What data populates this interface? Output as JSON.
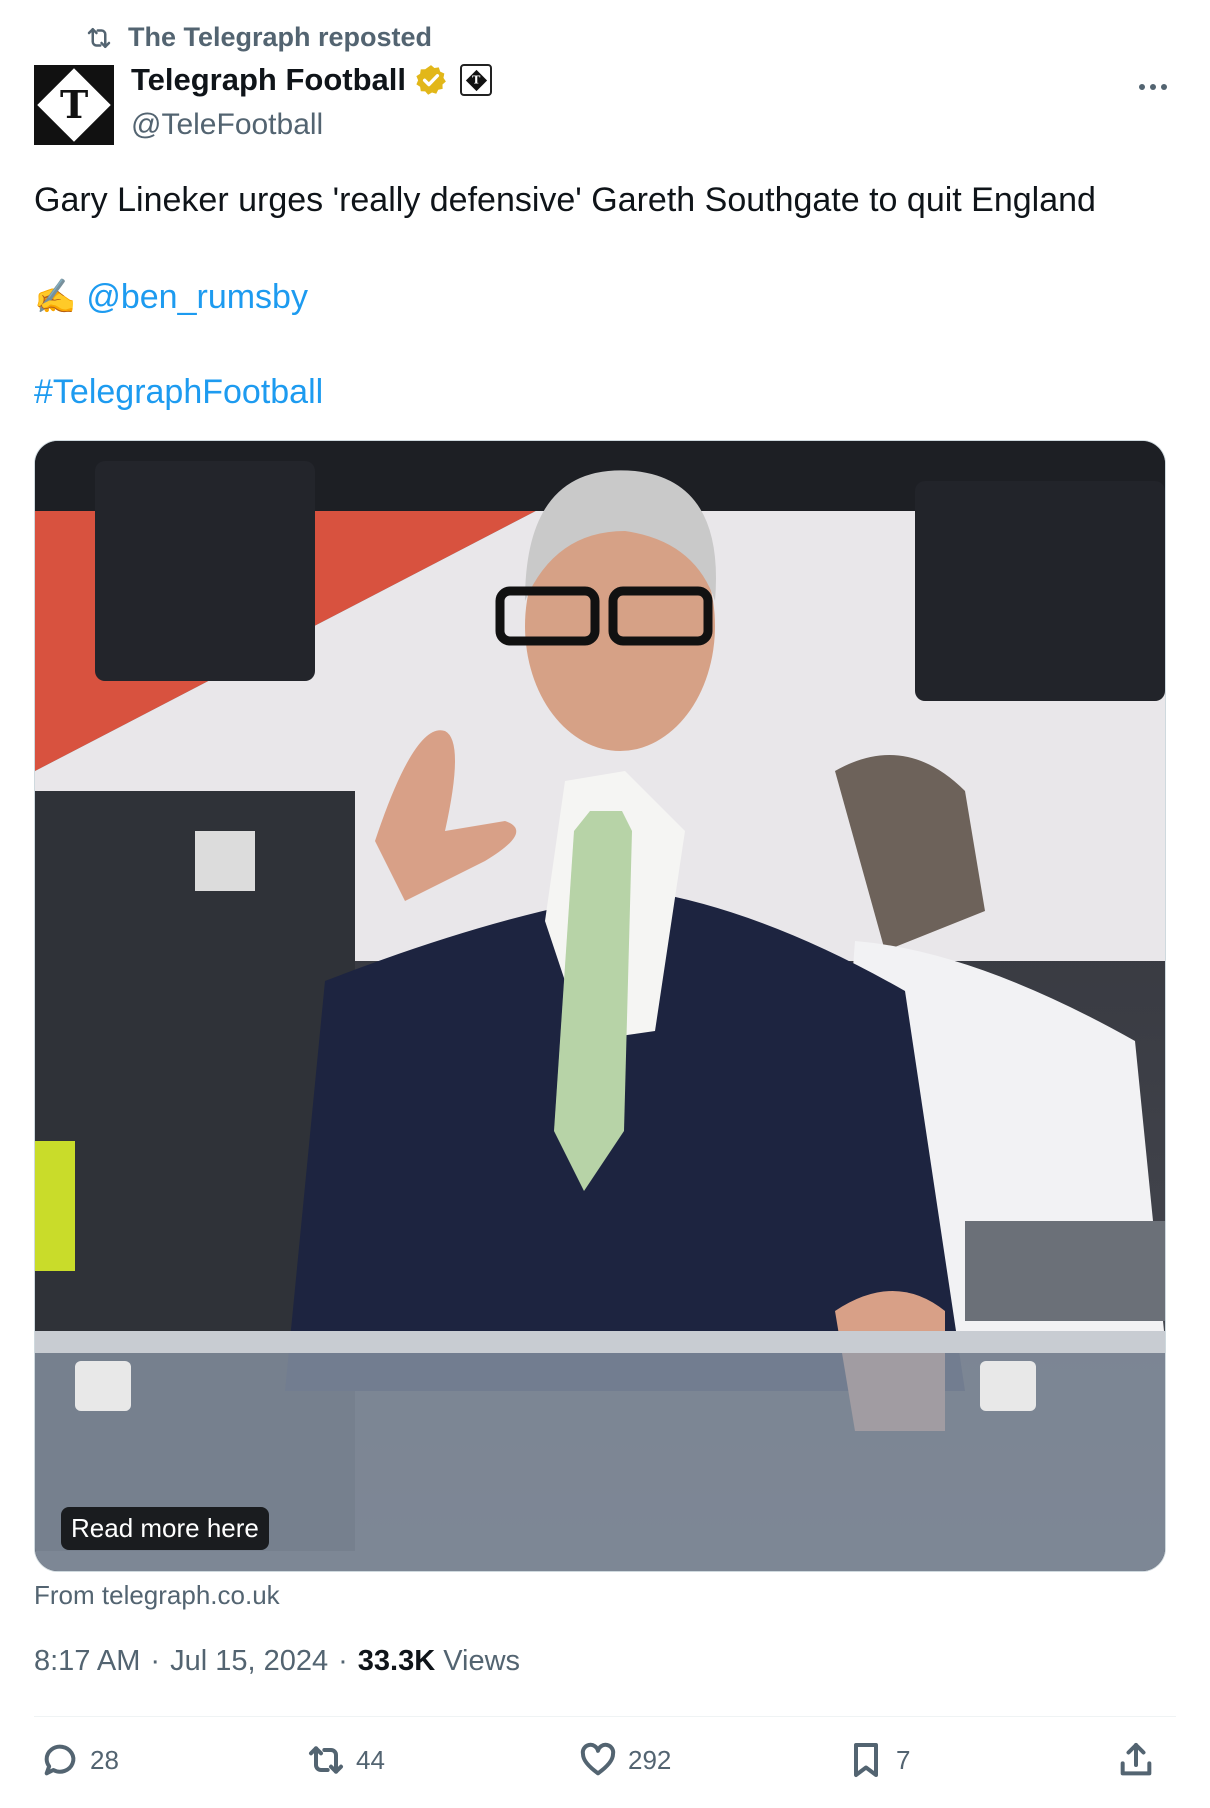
{
  "repost": {
    "label": "The Telegraph reposted",
    "icon": "repost-icon"
  },
  "author": {
    "display_name": "Telegraph Football",
    "handle": "@TeleFootball",
    "verified_color": "#e2b719",
    "avatar_letter": "T"
  },
  "tweet": {
    "headline": "Gary Lineker urges 'really defensive' Gareth Southgate to quit England",
    "pen_emoji": "✍️",
    "mention": "@ben_rumsby",
    "hashtag": "#TelegraphFootball",
    "link_color": "#1d9bf0"
  },
  "media": {
    "overlay_label": "Read more here",
    "source": "From telegraph.co.uk"
  },
  "meta": {
    "time": "8:17 AM",
    "sep": "·",
    "date": "Jul 15, 2024",
    "views_count": "33.3K",
    "views_label": "Views"
  },
  "actions": {
    "replies": "28",
    "reposts": "44",
    "likes": "292",
    "bookmarks": "7"
  }
}
